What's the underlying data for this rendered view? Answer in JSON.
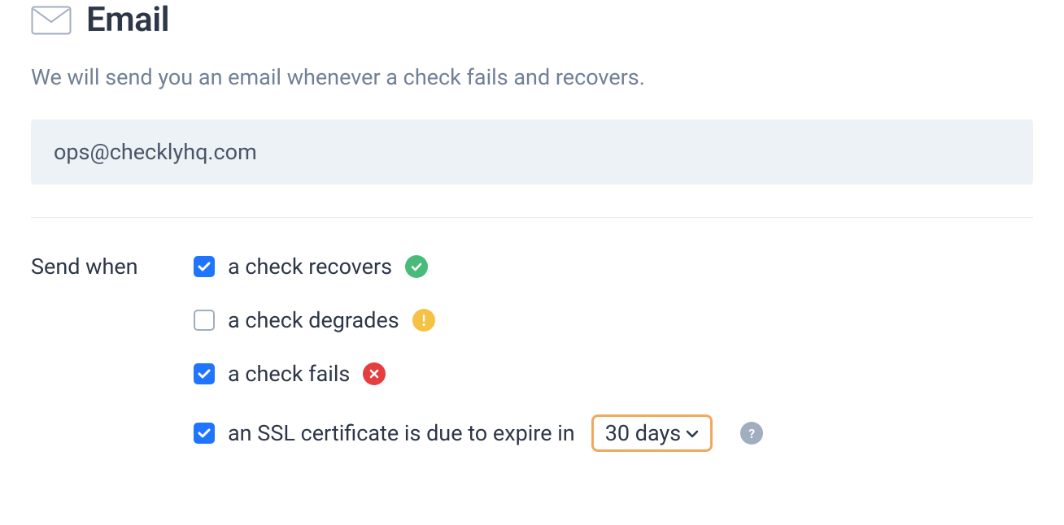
{
  "header": {
    "title": "Email"
  },
  "subtitle": "We will send you an email whenever a check fails and recovers.",
  "email_field": {
    "value": "ops@checklyhq.com"
  },
  "send_when": {
    "label": "Send when",
    "options": [
      {
        "label": "a check recovers",
        "checked": true,
        "status": "success"
      },
      {
        "label": "a check degrades",
        "checked": false,
        "status": "warn"
      },
      {
        "label": "a check fails",
        "checked": true,
        "status": "fail"
      },
      {
        "label": "an SSL certificate is due to expire in",
        "checked": true,
        "status": null
      }
    ],
    "ssl_expiry_select": {
      "value": "30 days"
    }
  },
  "help_label": "?"
}
